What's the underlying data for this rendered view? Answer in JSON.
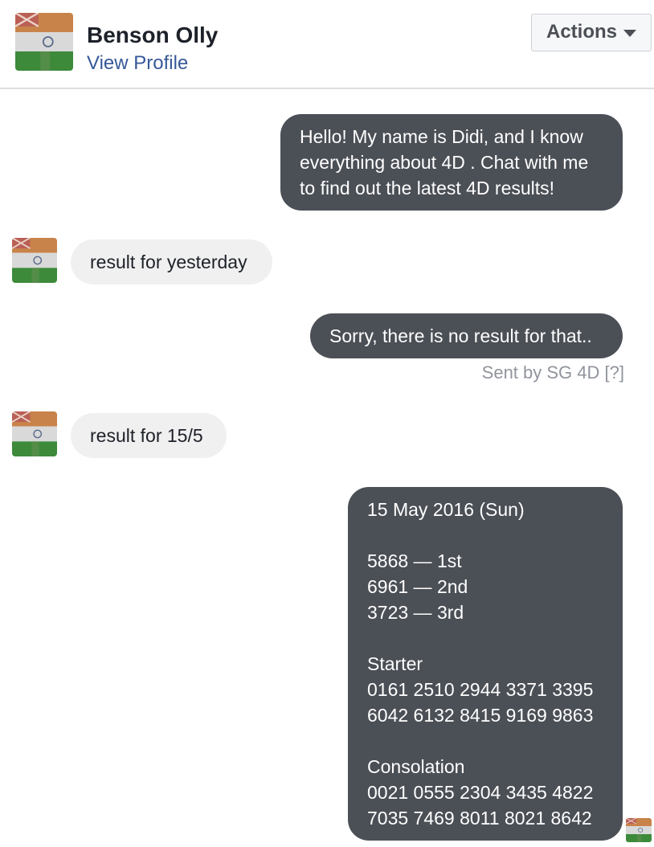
{
  "header": {
    "name": "Benson Olly",
    "view_profile": "View Profile",
    "actions_label": "Actions",
    "avatar_icon": "user-avatar-flag-icon"
  },
  "messages": [
    {
      "direction": "outgoing",
      "text": "Hello! My name is Didi, and I know\neverything about 4D . Chat with me\nto find out the latest 4D results!"
    },
    {
      "direction": "incoming",
      "text": "result for yesterday"
    },
    {
      "direction": "outgoing",
      "text": "Sorry, there is no result for that..",
      "sent_by": "Sent by SG 4D",
      "sent_by_help": "[?]"
    },
    {
      "direction": "incoming",
      "text": "result for 15/5"
    },
    {
      "direction": "outgoing",
      "text": "15 May 2016 (Sun)\n\n5868 — 1st\n6961 — 2nd\n3723 — 3rd\n\nStarter\n0161 2510 2944 3371 3395\n6042 6132 8415 9169 9863\n\nConsolation\n0021 0555 2304 3435 4822\n7035 7469 8011 8021 8642"
    }
  ],
  "colors": {
    "outgoing_bubble": "#4b4f56",
    "incoming_bubble": "#f1f0f0",
    "link": "#365899",
    "muted": "#90949c"
  }
}
